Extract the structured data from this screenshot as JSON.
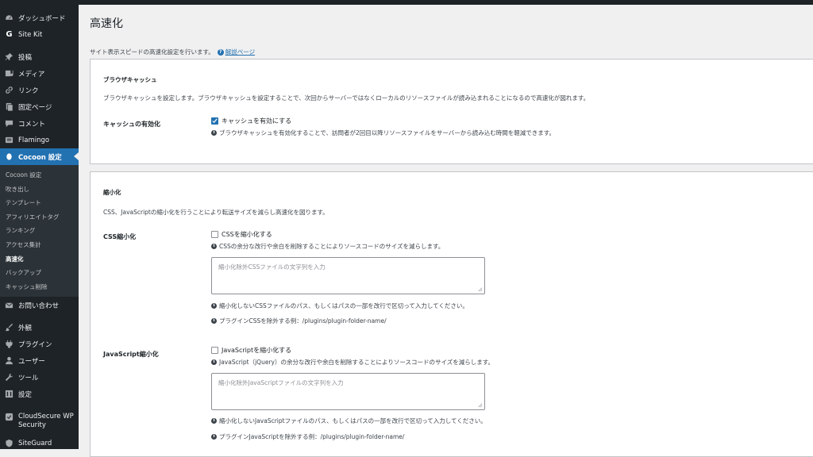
{
  "sidebar": {
    "items_top": [
      {
        "label": "ダッシュボード",
        "icon": "dashboard-icon"
      },
      {
        "label": "Site Kit",
        "icon": "site-kit-icon"
      }
    ],
    "items_mid": [
      {
        "label": "投稿",
        "icon": "pin-icon"
      },
      {
        "label": "メディア",
        "icon": "media-icon"
      },
      {
        "label": "リンク",
        "icon": "link-icon"
      },
      {
        "label": "固定ページ",
        "icon": "page-icon"
      },
      {
        "label": "コメント",
        "icon": "comment-icon"
      },
      {
        "label": "Flamingo",
        "icon": "flamingo-icon"
      }
    ],
    "current": {
      "label": "Cocoon 設定",
      "icon": "cocoon-icon"
    },
    "submenu": [
      "Cocoon 設定",
      "吹き出し",
      "テンプレート",
      "アフィリエイトタグ",
      "ランキング",
      "アクセス集計",
      "高速化",
      "バックアップ",
      "キャッシュ削除"
    ],
    "submenu_active_index": 6,
    "contact": {
      "label": "お問い合わせ",
      "icon": "mail-icon"
    },
    "items_bottom": [
      {
        "label": "外観",
        "icon": "brush-icon"
      },
      {
        "label": "プラグイン",
        "icon": "plugin-icon"
      },
      {
        "label": "ユーザー",
        "icon": "user-icon"
      },
      {
        "label": "ツール",
        "icon": "wrench-icon"
      },
      {
        "label": "設定",
        "icon": "settings-icon"
      }
    ],
    "cloudsecure": {
      "label": "CloudSecure WP Security",
      "icon": "cloudsecure-icon"
    },
    "siteguard": {
      "label": "SiteGuard",
      "icon": "siteguard-icon"
    }
  },
  "page": {
    "title": "高速化",
    "description": "サイト表示スピードの高速化設定を行います。",
    "help_link": "解説ページ"
  },
  "browser_cache": {
    "title": "ブラウザキャッシュ",
    "description": "ブラウザキャッシュを設定します。ブラウザキャッシュを設定することで、次回からサーバーではなくローカルのリソースファイルが読み込まれることになるので高速化が図れます。",
    "label": "キャッシュの有効化",
    "checkbox_label": "キャッシュを有効にする",
    "checked": true,
    "note": "ブラウザキャッシュを有効化することで、訪問者が2回目以降リソースファイルをサーバーから読み込む時間を軽減できます。"
  },
  "minify": {
    "title": "縮小化",
    "description": "CSS、JavaScriptの縮小化を行うことにより転送サイズを減らし高速化を図ります。",
    "css": {
      "label": "CSS縮小化",
      "checkbox_label": "CSSを縮小化する",
      "checked": false,
      "note": "CSSの余分な改行や余白を削除することによりソースコードのサイズを減らします。",
      "placeholder": "縮小化除外CSSファイルの文字列を入力",
      "exclude_note": "縮小化しないCSSファイルのパス、もしくはパスの一部を改行で区切って入力してください。",
      "example": "プラグインCSSを除外する例：/plugins/plugin-folder-name/"
    },
    "js": {
      "label": "JavaScript縮小化",
      "checkbox_label": "JavaScriptを縮小化する",
      "checked": false,
      "note": "JavaScript（jQuery）の余分な改行や余白を削除することによりソースコードのサイズを減らします。",
      "placeholder": "縮小化除外JavaScriptファイルの文字列を入力",
      "exclude_note": "縮小化しないJavaScriptファイルのパス、もしくはパスの一部を改行で区切って入力してください。",
      "example": "プラグインJavaScriptを除外する例：/plugins/plugin-folder-name/"
    }
  }
}
